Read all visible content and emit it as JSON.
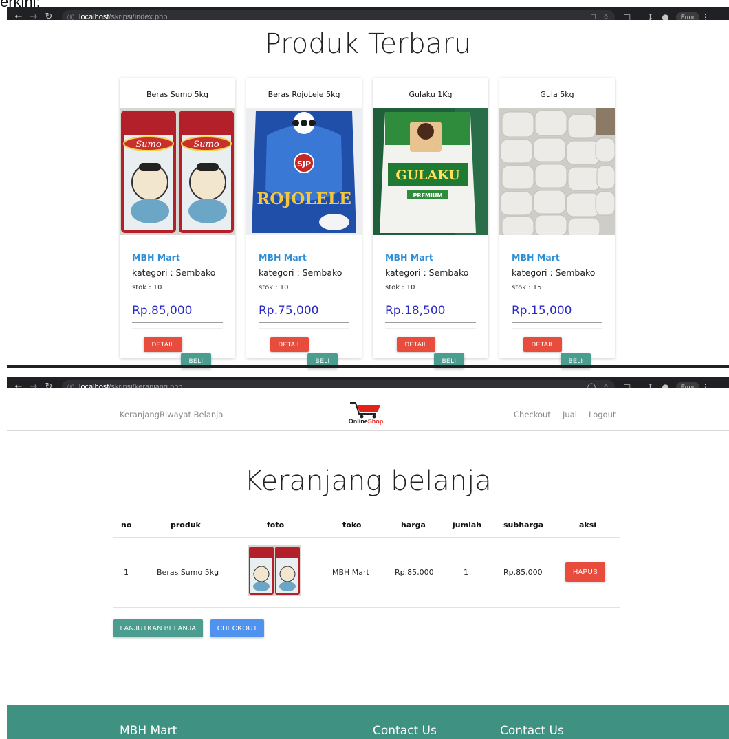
{
  "top_fragment": "erkini:",
  "browser_top": {
    "host": "localhost",
    "path": "/skripsi/index.php",
    "error_label": "Error"
  },
  "browser_bottom": {
    "host": "localhost",
    "path": "/skripsi/keranjang.php",
    "error_label": "Error"
  },
  "products_page": {
    "title": "Produk Terbaru",
    "products": [
      {
        "name": "Beras Sumo 5kg",
        "store": "MBH Mart",
        "category": "kategori : Sembako",
        "stock": "stok : 10",
        "price": "Rp.85,000",
        "detail_label": "DETAIL",
        "buy_label": "BELI"
      },
      {
        "name": "Beras RojoLele 5kg",
        "store": "MBH Mart",
        "category": "kategori : Sembako",
        "stock": "stok : 10",
        "price": "Rp.75,000",
        "detail_label": "DETAIL",
        "buy_label": "BELI"
      },
      {
        "name": "Gulaku 1Kg",
        "store": "MBH Mart",
        "category": "kategori : Sembako",
        "stock": "stok : 10",
        "price": "Rp.18,500",
        "detail_label": "DETAIL",
        "buy_label": "BELI"
      },
      {
        "name": "Gula 5kg",
        "store": "MBH Mart",
        "category": "kategori : Sembako",
        "stock": "stok : 15",
        "price": "Rp.15,000",
        "detail_label": "DETAIL",
        "buy_label": "BELI"
      }
    ],
    "image_text": {
      "sumo": "Sumo",
      "sjp": "SJP",
      "rojolele": "ROJOLELE",
      "gulaku": "GULAKU",
      "premium": "PREMIUM"
    }
  },
  "navbar": {
    "left": [
      "Keranjang",
      "Riwayat Belanja"
    ],
    "right": [
      "Checkout",
      "Jual",
      "Logout"
    ],
    "logo_a": "Online",
    "logo_b": "Shop"
  },
  "cart": {
    "title": "Keranjang belanja",
    "headers": [
      "no",
      "produk",
      "foto",
      "toko",
      "harga",
      "jumlah",
      "subharga",
      "aksi"
    ],
    "rows": [
      {
        "no": "1",
        "product": "Beras Sumo 5kg",
        "store": "MBH Mart",
        "price": "Rp.85,000",
        "qty": "1",
        "subtotal": "Rp.85,000",
        "action": "HAPUS"
      }
    ],
    "continue_label": "LANJUTKAN BELANJA",
    "checkout_label": "CHECKOUT"
  },
  "footer": {
    "brand": "MBH Mart",
    "contact_1": "Contact Us",
    "contact_2": "Contact Us"
  },
  "colors": {
    "chrome": "#202124",
    "store_blue": "#2e8fd8",
    "price_blue": "#2a2ac7",
    "detail_red": "#e84c3d",
    "beli_teal": "#4a9d8f",
    "checkout_blue": "#4f93ef",
    "footer_teal": "#3f9181"
  }
}
